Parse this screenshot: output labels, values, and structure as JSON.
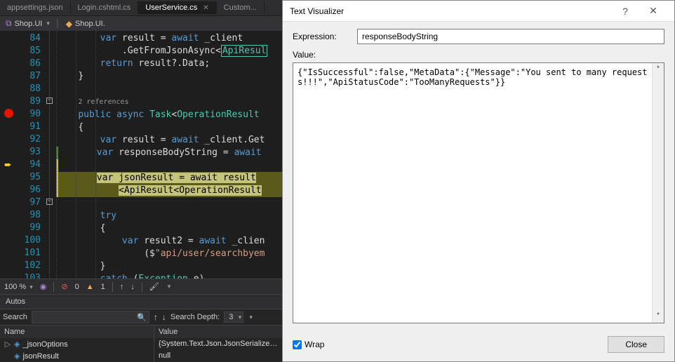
{
  "tabs": {
    "t0": "appsettings.json",
    "t1": "Login.cshtml.cs",
    "t2": "UserService.cs",
    "t3": "Custom..."
  },
  "nav": {
    "project": "Shop.UI",
    "namespace": "Shop.UI."
  },
  "lines": {
    "l84": "84",
    "l85": "85",
    "l86": "86",
    "l87": "87",
    "l88": "88",
    "l89": "89",
    "l90": "90",
    "l91": "91",
    "l92": "92",
    "l93": "93",
    "l94": "94",
    "l95": "95",
    "l96": "96",
    "l97": "97",
    "l98": "98",
    "l99": "99",
    "l100": "100",
    "l101": "101",
    "l102": "102",
    "l103": "103"
  },
  "code": {
    "c84a": "var",
    "c84b": " result = ",
    "c84c": "await",
    "c84d": " _client",
    "c85a": ".GetFromJsonAsync<",
    "c85b": "ApiResul",
    "c86a": "return",
    "c86b": " result?.Data;",
    "c87a": "}",
    "codelens": "2 references",
    "c89a": "public",
    "c89b": " async ",
    "c89c": "Task",
    "c89d": "<",
    "c89e": "OperationResult",
    "c90a": "{",
    "c91a": "var",
    "c91b": " result = ",
    "c91c": "await",
    "c91d": " _client.Get",
    "c92a": "var",
    "c92b": " responseBodyString = ",
    "c92c": "await",
    "c94a": "var",
    "c94b": " jsonResult = ",
    "c94c": "await",
    "c94d": " result",
    "c95a": "<",
    "c95b": "ApiResult",
    "c95c": "<",
    "c95d": "OperationResult",
    "c97a": "try",
    "c98a": "{",
    "c99a": "var",
    "c99b": " result2 = ",
    "c99c": "await",
    "c99d": " _clien",
    "c100a": "($",
    "c100b": "\"api/user/searchbyem",
    "c101a": "}",
    "c102a": "catch",
    "c102b": " (",
    "c102c": "Exception",
    "c102d": " e)",
    "c103a": "{"
  },
  "status": {
    "zoom": "100 %",
    "err_count": "0",
    "warn_count": "1"
  },
  "autos": {
    "title": "Autos",
    "search_label": "Search",
    "search_ph": "",
    "depth_label": "Search Depth:",
    "depth_value": "3",
    "col_name": "Name",
    "col_value": "Value",
    "rows": [
      {
        "name": "_jsonOptions",
        "value": "{System.Text.Json.JsonSerializerO"
      },
      {
        "name": "jsonResult",
        "value": "null"
      }
    ]
  },
  "dialog": {
    "title": "Text Visualizer",
    "help": "?",
    "close_glyph": "✕",
    "expr_label": "Expression:",
    "expr_value": "responseBodyString",
    "val_label": "Value:",
    "val_text": "{\"IsSuccessful\":false,\"MetaData\":{\"Message\":\"You sent to many requests!!!\",\"ApiStatusCode\":\"TooManyRequests\"}}",
    "wrap_label": "Wrap",
    "close_label": "Close"
  }
}
